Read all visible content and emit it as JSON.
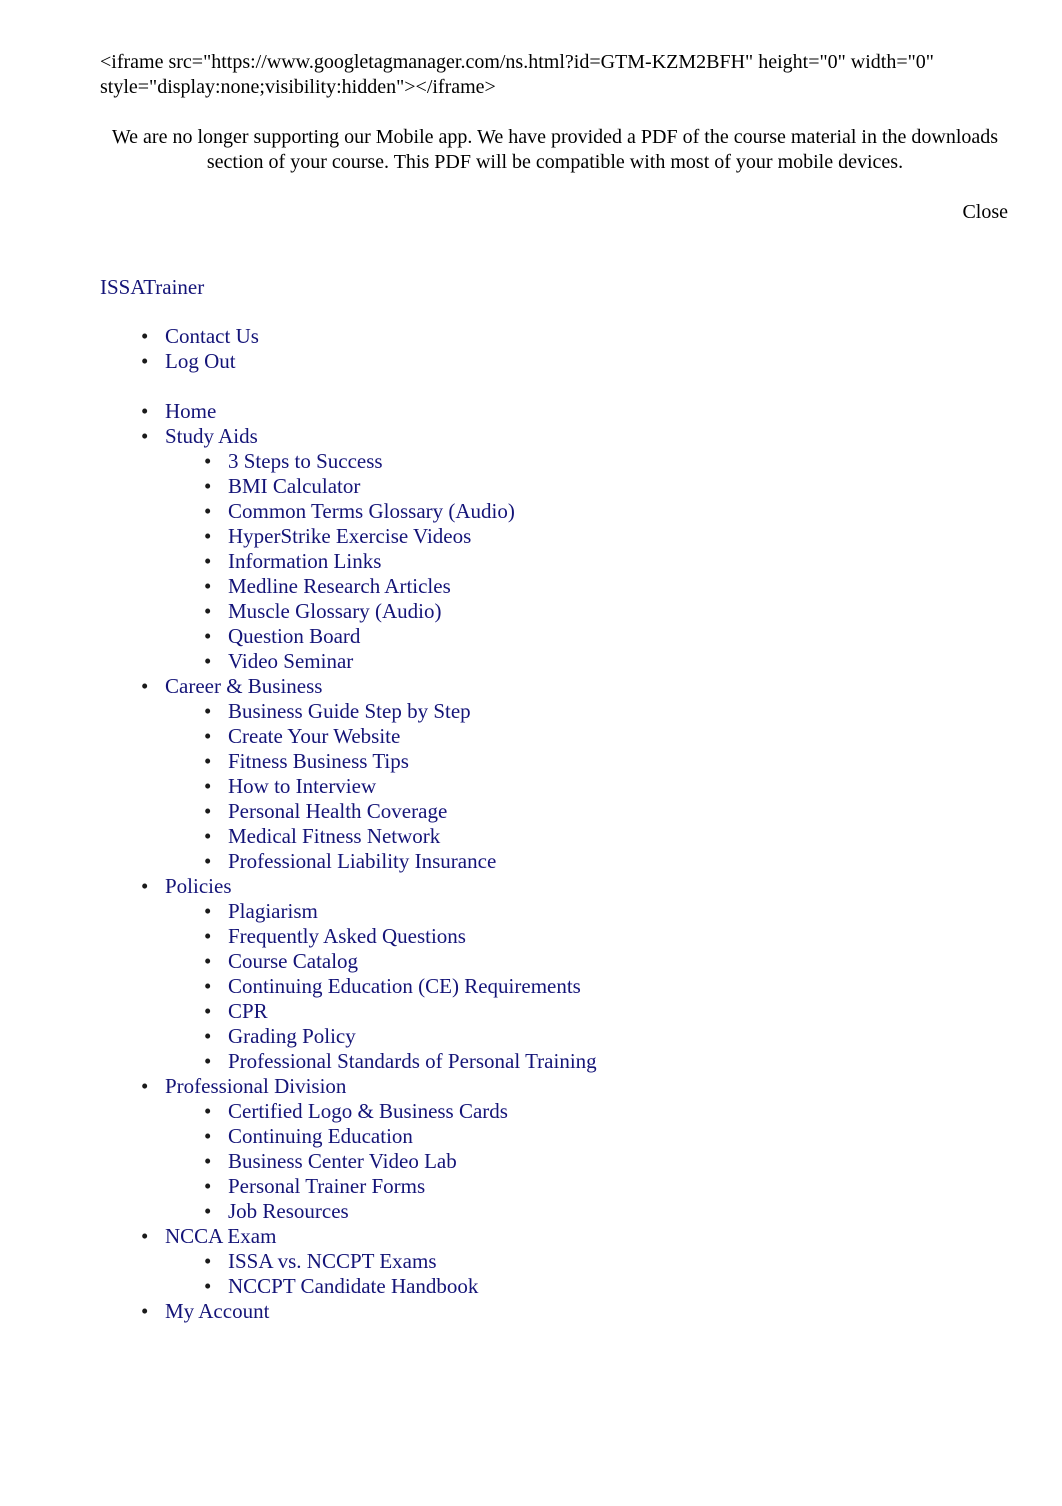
{
  "page": {
    "iframe_code": "<iframe src=\"https://www.googletagmanager.com/ns.html?id=GTM-KZM2BFH\" height=\"0\" width=\"0\" style=\"display:none;visibility:hidden\"></iframe>"
  },
  "notice": {
    "message": "We are no longer supporting our Mobile app. We have provided a PDF of the course material in the downloads section of your course. This PDF will be compatible with most of your mobile devices.",
    "close_label": "Close"
  },
  "site": {
    "title": "ISSATrainer"
  },
  "utility_nav": {
    "items": [
      {
        "label": "Contact Us"
      },
      {
        "label": "Log Out"
      }
    ]
  },
  "main_nav": {
    "items": [
      {
        "label": "Home",
        "children": []
      },
      {
        "label": "Study Aids",
        "children": [
          {
            "label": "3 Steps to Success"
          },
          {
            "label": "BMI Calculator"
          },
          {
            "label": "Common Terms Glossary (Audio)"
          },
          {
            "label": "HyperStrike Exercise Videos"
          },
          {
            "label": "Information Links"
          },
          {
            "label": "Medline Research Articles"
          },
          {
            "label": "Muscle Glossary (Audio)"
          },
          {
            "label": "Question Board"
          },
          {
            "label": "Video Seminar"
          }
        ]
      },
      {
        "label": "Career & Business",
        "children": [
          {
            "label": "Business Guide Step by Step"
          },
          {
            "label": "Create Your Website"
          },
          {
            "label": "Fitness Business Tips"
          },
          {
            "label": "How to Interview"
          },
          {
            "label": "Personal Health Coverage"
          },
          {
            "label": "Medical Fitness Network"
          },
          {
            "label": "Professional Liability Insurance"
          }
        ]
      },
      {
        "label": "Policies",
        "children": [
          {
            "label": "Plagiarism"
          },
          {
            "label": "Frequently Asked Questions"
          },
          {
            "label": "Course Catalog"
          },
          {
            "label": "Continuing Education (CE) Requirements"
          },
          {
            "label": "CPR"
          },
          {
            "label": "Grading Policy"
          },
          {
            "label": "Professional Standards of Personal Training"
          }
        ]
      },
      {
        "label": "Professional Division",
        "children": [
          {
            "label": "Certified Logo & Business Cards"
          },
          {
            "label": "Continuing Education"
          },
          {
            "label": "Business Center Video Lab"
          },
          {
            "label": "Personal Trainer Forms"
          },
          {
            "label": "Job Resources"
          }
        ]
      },
      {
        "label": "NCCA Exam",
        "children": [
          {
            "label": "ISSA vs. NCCPT Exams"
          },
          {
            "label": "NCCPT Candidate Handbook"
          }
        ]
      },
      {
        "label": "My Account",
        "children": []
      }
    ]
  },
  "colors": {
    "link": "#141478",
    "text": "#000000",
    "background": "#ffffff"
  }
}
